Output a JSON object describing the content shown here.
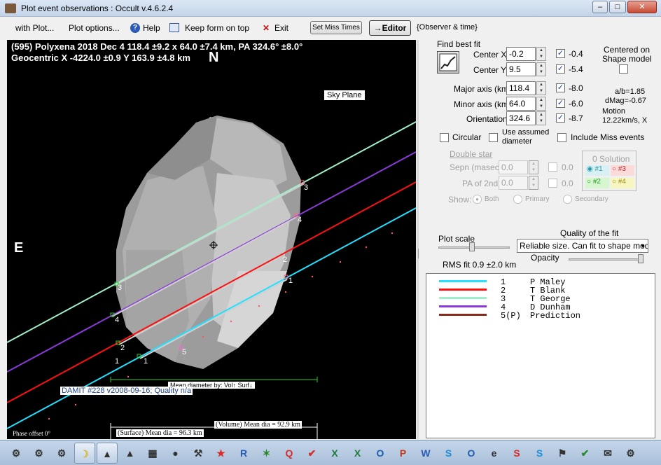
{
  "window": {
    "title": "Plot event observations : Occult v.4.6.2.4"
  },
  "menu": {
    "with_plot": "with Plot...",
    "plot_options": "Plot options...",
    "help": "Help",
    "keep_on_top": "Keep form on top",
    "exit": "Exit",
    "set_miss_times": "Set Miss Times",
    "editor": "→Editor",
    "observer_time": "{Observer & time}"
  },
  "plot": {
    "header_line1": "(595) Polyxena  2018 Dec 4   118.4 ±9.2 x 64.0 ±7.4 km,  PA 324.6° ±8.0°",
    "header_line2": "Geocentric  X  -4224.0 ±0.9   Y 163.9 ±4.8 km",
    "north": "N",
    "east": "E",
    "sky_plane": "Sky Plane",
    "damit": "DAMIT #228 v2008-09-16; Quality n/a",
    "mean_diameter_by": "Mean diameter by: Vol↑ Surf↓",
    "volume_mean": "(Volume) Mean dia = 92.9 km",
    "surface_mean": "(Surface) Mean dia = 96.3 km",
    "phase_offset": "Phase offset 0°",
    "chord_labels": [
      "1",
      "2",
      "3",
      "4",
      "5"
    ]
  },
  "fit": {
    "title": "Find best fit",
    "center_x_label": "Center X",
    "center_x": "-0.2",
    "center_x_unc": "-0.4",
    "center_y_label": "Center Y",
    "center_y": "9.5",
    "center_y_unc": "-5.4",
    "centered_on": "Centered on",
    "shape_model": "Shape model",
    "major_label": "Major axis (km)",
    "major": "118.4",
    "major_unc": "-8.0",
    "minor_label": "Minor axis (km)",
    "minor": "64.0",
    "minor_unc": "-6.0",
    "orient_label": "Orientation",
    "orient": "324.6",
    "orient_unc": "-8.7",
    "ab_ratio": "a/b=1.85",
    "dmag": "dMag=-0.67",
    "motion_label": "Motion",
    "motion": "12.22km/s, X",
    "circular": "Circular",
    "use_assumed": "Use assumed",
    "diameter": "diameter",
    "include_miss": "Include Miss events"
  },
  "double_star": {
    "title": "Double star",
    "sepn_label": "Sepn (masec)",
    "sepn": "0.0",
    "sepn_unc": "0.0",
    "pa_label": "PA of 2nd",
    "pa": "0.0",
    "pa_unc": "0.0",
    "show_label": "Show:",
    "both": "Both",
    "primary": "Primary",
    "secondary": "Secondary",
    "solution_title": "0 Solution",
    "sol1": "#1",
    "sol2": "#2",
    "sol3": "#3",
    "sol4": "#4"
  },
  "scale": {
    "plot_scale": "Plot scale",
    "quality_label": "Quality of the fit",
    "quality_value": "Reliable size. Can fit to shape mode",
    "opacity": "Opacity",
    "rms": "RMS fit  0.9 ±2.0 km"
  },
  "legend": [
    {
      "num": "1",
      "name": "P Maley",
      "color": "#22e0ff"
    },
    {
      "num": "2",
      "name": "T Blank",
      "color": "#ff1010"
    },
    {
      "num": "3",
      "name": "T George",
      "color": "#9ff0c8"
    },
    {
      "num": "4",
      "name": "D Dunham",
      "color": "#8a3ad8"
    },
    {
      "num": "5(P)",
      "name": "Prediction",
      "color": "#8a2a1a"
    }
  ],
  "taskbar": {
    "items": [
      "network-icon",
      "network-icon",
      "network-icon",
      "moon-icon",
      "occult-icon",
      "occult-icon",
      "windows-icon",
      "globe-icon",
      "tool-icon",
      "star-icon",
      "r-icon",
      "map-icon",
      "q-icon",
      "check-icon",
      "excel-icon",
      "excel-icon",
      "outlook-icon",
      "powerpoint-icon",
      "word-icon",
      "s-icon",
      "outlook-icon",
      "explorer-icon",
      "skype-icon",
      "s-icon",
      "flag-icon",
      "security-icon",
      "mail-icon",
      "gear-icon"
    ]
  }
}
